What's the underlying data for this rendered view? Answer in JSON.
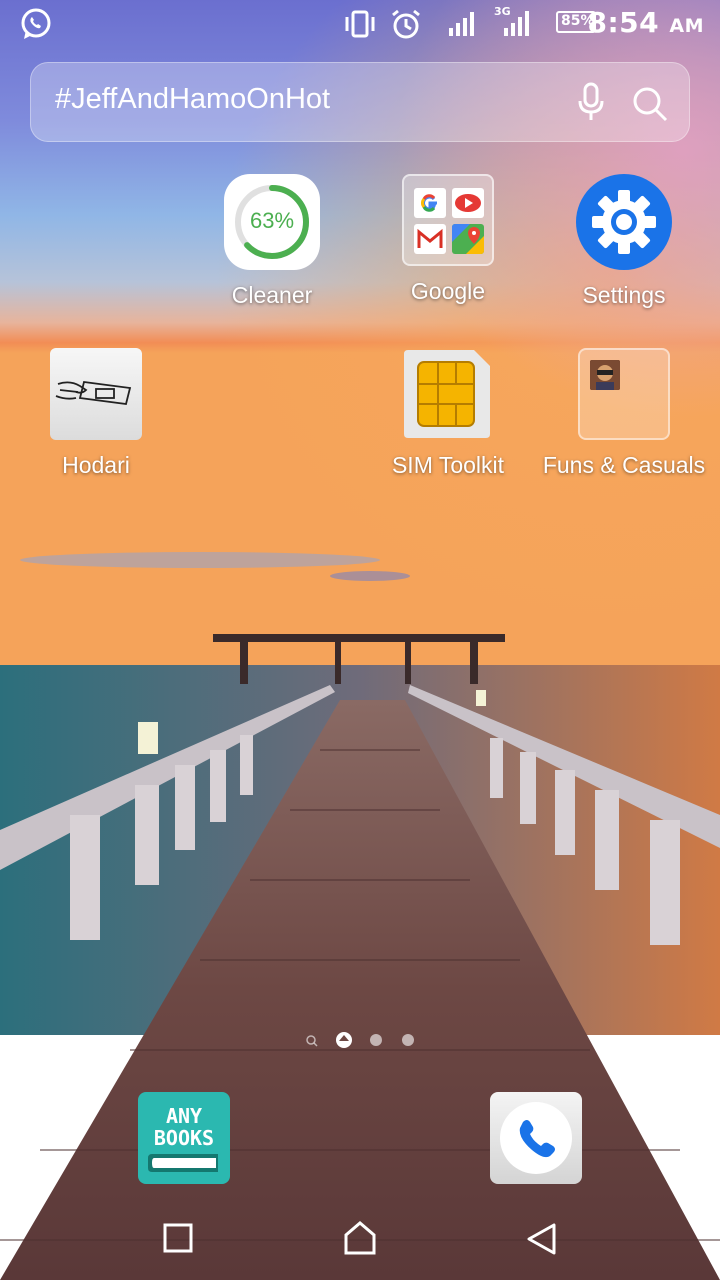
{
  "status_bar": {
    "battery": "85%",
    "time": "8:54",
    "ampm": "AM",
    "network_label": "3G",
    "icons": [
      "whatsapp-icon",
      "vibrate-icon",
      "alarm-icon",
      "signal-icon",
      "signal-3g-icon",
      "battery-icon"
    ]
  },
  "search": {
    "query": "#JeffAndHamoOnHot",
    "icons": [
      "mic-icon",
      "search-icon"
    ]
  },
  "apps": {
    "cleaner": {
      "label": "Cleaner",
      "percent": "63%",
      "progress": 0.63
    },
    "google": {
      "label": "Google"
    },
    "settings": {
      "label": "Settings"
    },
    "hodari": {
      "label": "Hodari"
    },
    "sim_toolkit": {
      "label": "SIM Toolkit"
    },
    "funs": {
      "label": "Funs & Casuals"
    }
  },
  "page_indicator": {
    "pages": 4,
    "current": 1
  },
  "dock": {
    "anybooks_line1": "ANY",
    "anybooks_line2": "BOOKS"
  },
  "colors": {
    "settings_blue": "#1a73e8",
    "cleaner_green": "#4caf50",
    "anybooks_teal": "#2bb8b0"
  }
}
